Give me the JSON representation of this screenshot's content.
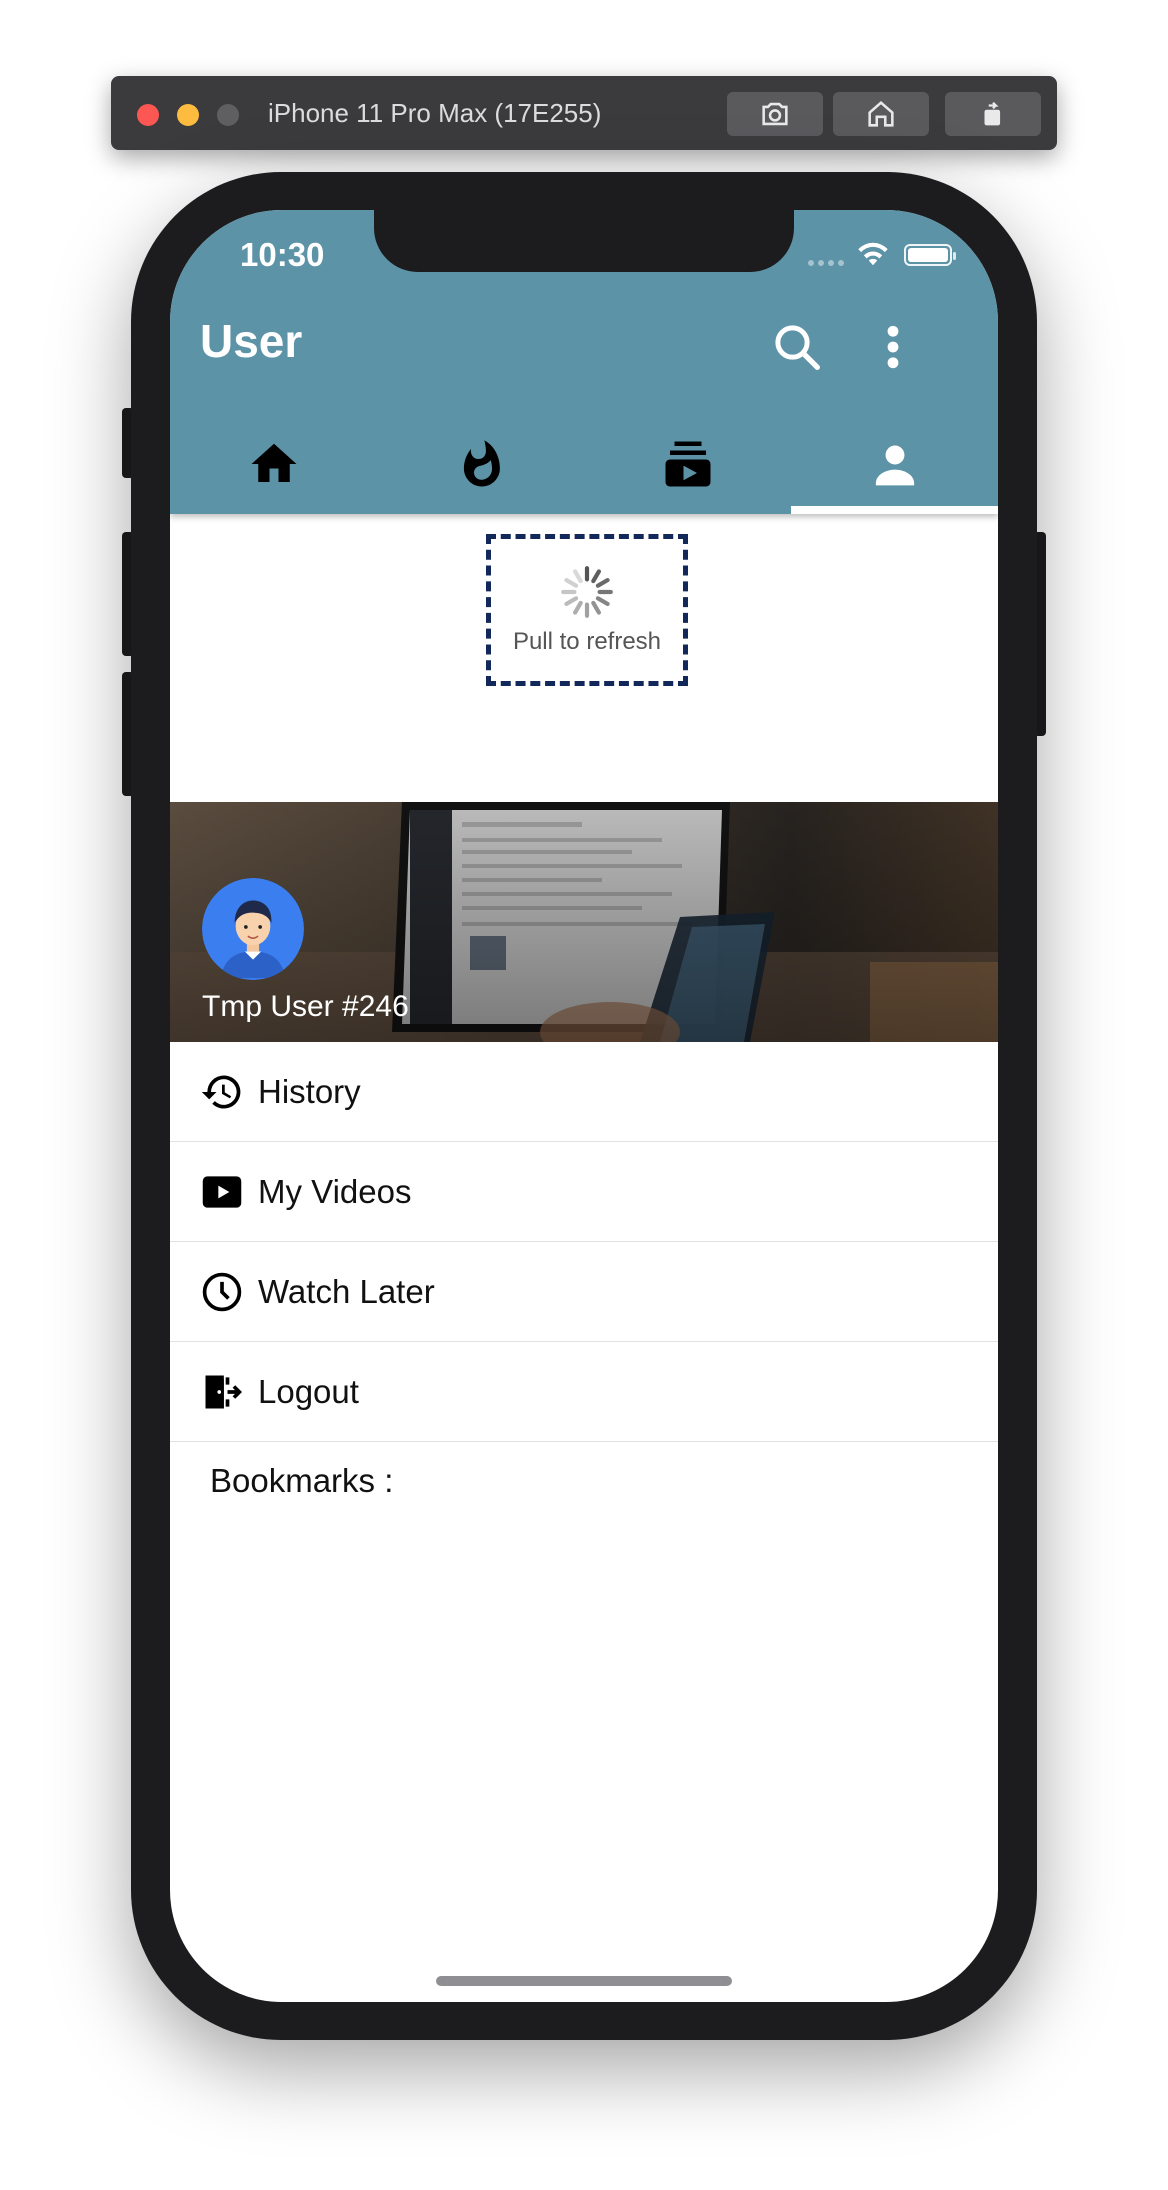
{
  "simulator": {
    "title": "iPhone 11 Pro Max (17E255)",
    "buttons": [
      "screenshot-icon",
      "home-icon",
      "rotate-icon"
    ]
  },
  "status_bar": {
    "time": "10:30"
  },
  "app_bar": {
    "title": "User",
    "actions": [
      "search-icon",
      "more-vert-icon"
    ],
    "background": "#5c93a7"
  },
  "tabs": [
    {
      "icon": "home-icon",
      "selected": false
    },
    {
      "icon": "fire-icon",
      "selected": false
    },
    {
      "icon": "subscriptions-icon",
      "selected": false
    },
    {
      "icon": "person-icon",
      "selected": true
    }
  ],
  "refresh": {
    "label": "Pull to refresh"
  },
  "profile": {
    "user_name": "Tmp User #246"
  },
  "menu": [
    {
      "label": "History",
      "icon": "history-icon"
    },
    {
      "label": "My Videos",
      "icon": "play-box-icon"
    },
    {
      "label": "Watch Later",
      "icon": "clock-icon"
    },
    {
      "label": "Logout",
      "icon": "logout-icon"
    }
  ],
  "bookmarks": {
    "label": "Bookmarks :"
  }
}
